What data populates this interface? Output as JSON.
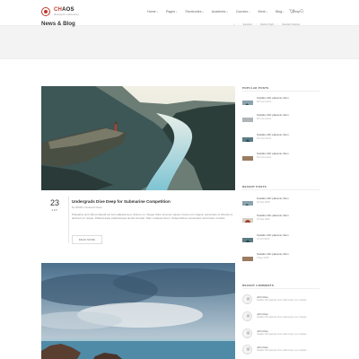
{
  "header": {
    "logo": {
      "title_accent": "CH",
      "title_rest": "AOS",
      "subtitle": "Research Laboratory"
    },
    "nav": [
      {
        "label": "Home"
      },
      {
        "label": "Pages"
      },
      {
        "label": "Shortcodes"
      },
      {
        "label": "Academic"
      },
      {
        "label": "Courses"
      },
      {
        "label": "Work"
      },
      {
        "label": "Blog"
      },
      {
        "label": "Shop"
      }
    ],
    "icons": [
      "cart-icon",
      "search-icon"
    ]
  },
  "title_band": {
    "title": "News & Blog",
    "breadcrumb": [
      "⌂",
      "Standard",
      "Sidebar Right",
      "Standard Sidebar"
    ]
  },
  "post": {
    "day": "23",
    "month": "SEP",
    "title": "Undergrads Dive Deep for Submarine Competition",
    "byline": "By ADMIN in Research News",
    "excerpt": "Phasellus enim libero blandit vel sem adipiscing ut, dictum mi. Integer dolor sit amet massa. Fusce orci magna, accumsan ut lobortis ut, lacinia in ut neque. Pellentesque pellentesque iaculis suscipit. Nam a aliquet lorem. Suspendisse consectetur accumsan ut tellus.",
    "read_more": "READ MORE"
  },
  "sidebar": {
    "popular_title": "POPULAR POSTS",
    "popular": [
      {
        "title": "Sodalis nibh placerat, illum",
        "sub": "45 Comments"
      },
      {
        "title": "Sodalis nibh placerat, illum",
        "sub": "36 Comments"
      },
      {
        "title": "Sodalis nibh placerat, illum",
        "sub": "25 Comments"
      },
      {
        "title": "Sodalis nibh placerat, illum",
        "sub": "18 Comments"
      }
    ],
    "recent_title": "RECENT POSTS",
    "recent": [
      {
        "title": "Sodalis nibh placerat, illum",
        "sub": "29 Sep 2015"
      },
      {
        "title": "Sodalis nibh placerat, illum",
        "sub": "25 Sep 2015"
      },
      {
        "title": "Sodalis nibh placerat, illum",
        "sub": "14 Oct 2015"
      },
      {
        "title": "Sodalis nibh placerat, illum",
        "sub": "9 Sep 2015"
      }
    ],
    "comments_title": "RECENT COMMENTS",
    "comments": [
      {
        "author": "John Doe",
        "text": "Sodalis nibh placerat, illum ullamcorper nec volutpat..."
      },
      {
        "author": "John Doe",
        "text": "Sodalis nibh placerat, illum ullamcorper nec volutpat..."
      },
      {
        "author": "John Doe",
        "text": "Sodalis nibh placerat, illum ullamcorper nec volutpat..."
      },
      {
        "author": "John Doe",
        "text": "Sodalis nibh placerat, illum ullamcorper nec volutpat..."
      }
    ]
  },
  "colors": {
    "accent": "#c0392b",
    "band": "#f3f3f3"
  }
}
